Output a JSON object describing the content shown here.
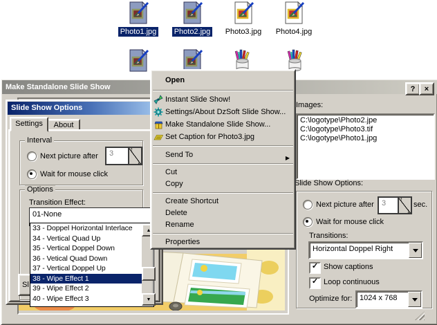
{
  "desktop": {
    "icons": [
      {
        "label": "Photo1.jpg",
        "selected": true
      },
      {
        "label": "Photo2.jpg",
        "selected": true
      },
      {
        "label": "Photo3.jpg",
        "selected": false
      },
      {
        "label": "Photo4.jpg",
        "selected": false
      }
    ]
  },
  "window": {
    "title": "Make Standalone Slide Show",
    "help_glyph": "?",
    "close_glyph": "×",
    "images_label": "Images:",
    "images": [
      "C:\\logotype\\Photo2.jpe",
      "C:\\logotype\\Photo3.tif",
      "C:\\logotype\\Photo1.jpg"
    ],
    "options_label": "Slide Show Options:",
    "next_picture_label": "Next picture after",
    "interval_value": "3",
    "seconds_label": "sec.",
    "wait_label": "Wait for mouse click",
    "transitions_label": "Transitions:",
    "transitions_value": "Horizontal Doppel Right",
    "show_captions_label": "Show captions",
    "loop_label": "Loop continuous",
    "optimize_label": "Optimize for:",
    "optimize_value": "1024 x 768",
    "check_glyph": "✓"
  },
  "dialog": {
    "title": "Slide Show Options",
    "tabs": [
      "Settings",
      "About"
    ],
    "interval_legend": "Interval",
    "next_picture_label": "Next picture after",
    "interval_value": "3",
    "wait_label": "Wait for mouse click",
    "options_legend": "Options",
    "transition_label": "Transition Effect:",
    "transition_value": "01-None",
    "transition_list": [
      "33 - Doppel Horizontal Interlace",
      "34 - Vertical Quad Up",
      "35 - Vertical Doppel Down",
      "36 - Vetical Quad Down",
      "37 - Vertical Doppel Up",
      "38 - Wipe Effect 1",
      "39 - Wipe Effect 2",
      "40 - Wipe Effect 3"
    ],
    "selected_transition": "38 - Wipe Effect 1",
    "partial_button_label": "Sl"
  },
  "menu": {
    "open_label": "Open",
    "instant": "Instant Slide Show!",
    "settings_about": "Settings/About DzSoft Slide Show...",
    "make_standalone": "Make Standalone Slide Show...",
    "set_caption": "Set Caption for Photo3.jpg",
    "send_to": "Send To",
    "cut": "Cut",
    "copy": "Copy",
    "create_shortcut": "Create Shortcut",
    "delete_label": "Delete",
    "rename": "Rename",
    "properties": "Properties",
    "submenu_arrow": "▶"
  },
  "colors": {
    "face": "#d4d0c8",
    "selection": "#0a246a",
    "active_title_start": "#0a246a",
    "active_title_end": "#a6caf0",
    "inactive_title_start": "#878783",
    "inactive_title_end": "#cfcdc4"
  }
}
